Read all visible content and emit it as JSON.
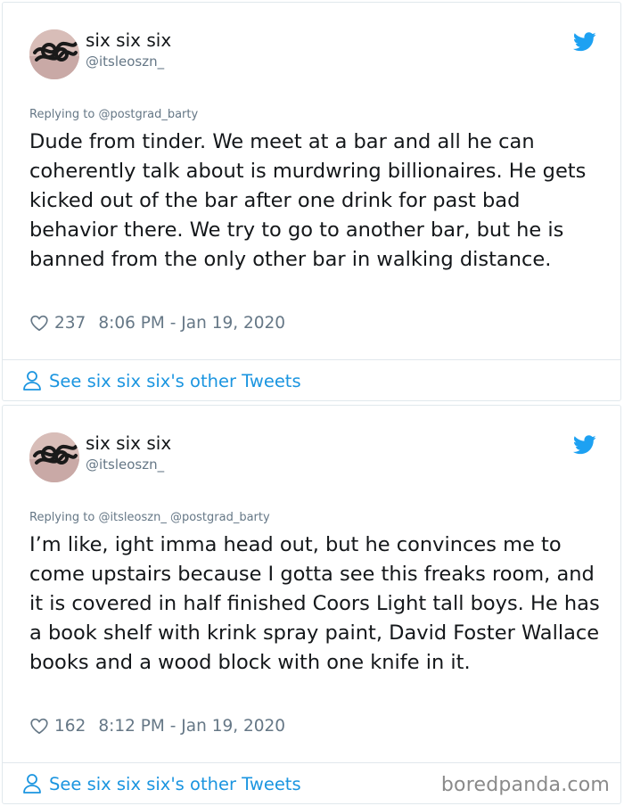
{
  "tweets": [
    {
      "display_name": "six six six",
      "handle": "@itsleoszn_",
      "replying_prefix": "Replying to",
      "replying_to": "@postgrad_barty",
      "text": "Dude from tinder. We meet at a bar and all he can coherently talk about is murdwring billionaires. He gets kicked out of the bar after one drink for past bad behavior there. We try to go to another bar, but he is banned from the only other bar in walking distance.",
      "likes": "237",
      "timestamp": "8:06 PM - Jan 19, 2020",
      "footer_link": "See six six six's other Tweets"
    },
    {
      "display_name": "six six six",
      "handle": "@itsleoszn_",
      "replying_prefix": "Replying to",
      "replying_to": "@itsleoszn_ @postgrad_barty",
      "text": "I’m like, ight imma head out, but he convinces me to come upstairs because I gotta see this freaks room, and it is covered in half finished Coors Light tall boys. He has a book shelf with krink spray paint, David Foster Wallace books and a wood block with one knife in it.",
      "likes": "162",
      "timestamp": "8:12 PM - Jan 19, 2020",
      "footer_link": "See six six six's other Tweets"
    }
  ],
  "watermark": "boredpanda.com",
  "colors": {
    "link": "#1b95e0",
    "muted": "#657786",
    "border": "#e1e8ed",
    "text": "#14171a"
  },
  "icons": {
    "brand": "twitter-bird-icon",
    "like": "heart-icon",
    "profile": "person-icon"
  }
}
